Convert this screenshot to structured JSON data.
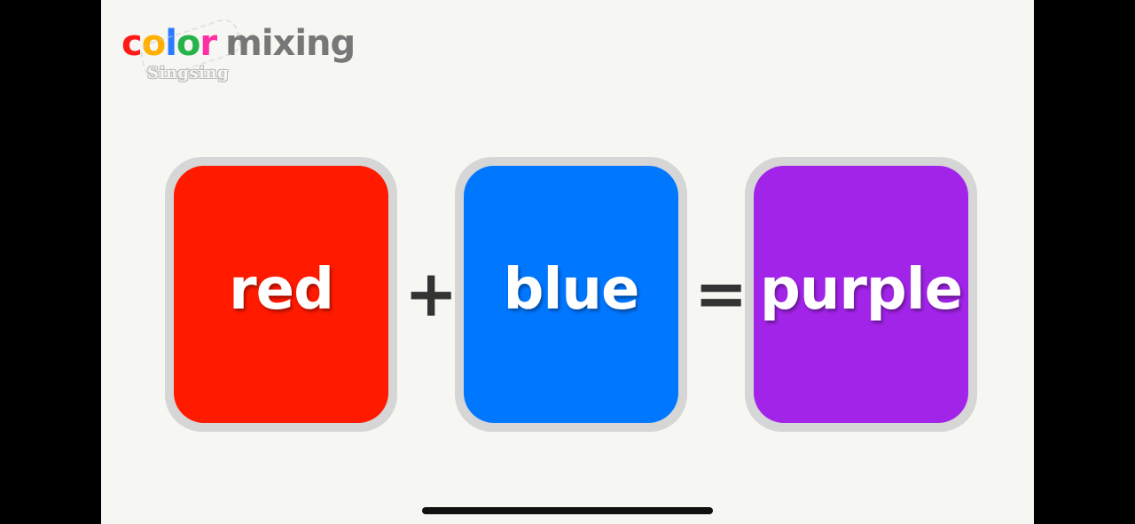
{
  "title": {
    "part1": "c",
    "part2": "o",
    "part3": "l",
    "part4": "o",
    "part5": "r",
    "rest": "mixing"
  },
  "watermark": "Singsing",
  "equation": {
    "first": {
      "label": "red",
      "color": "#ff1a00"
    },
    "operator1": "+",
    "second": {
      "label": "blue",
      "color": "#0077ff"
    },
    "operator2": "=",
    "result": {
      "label": "purple",
      "color": "#a224e8"
    }
  }
}
